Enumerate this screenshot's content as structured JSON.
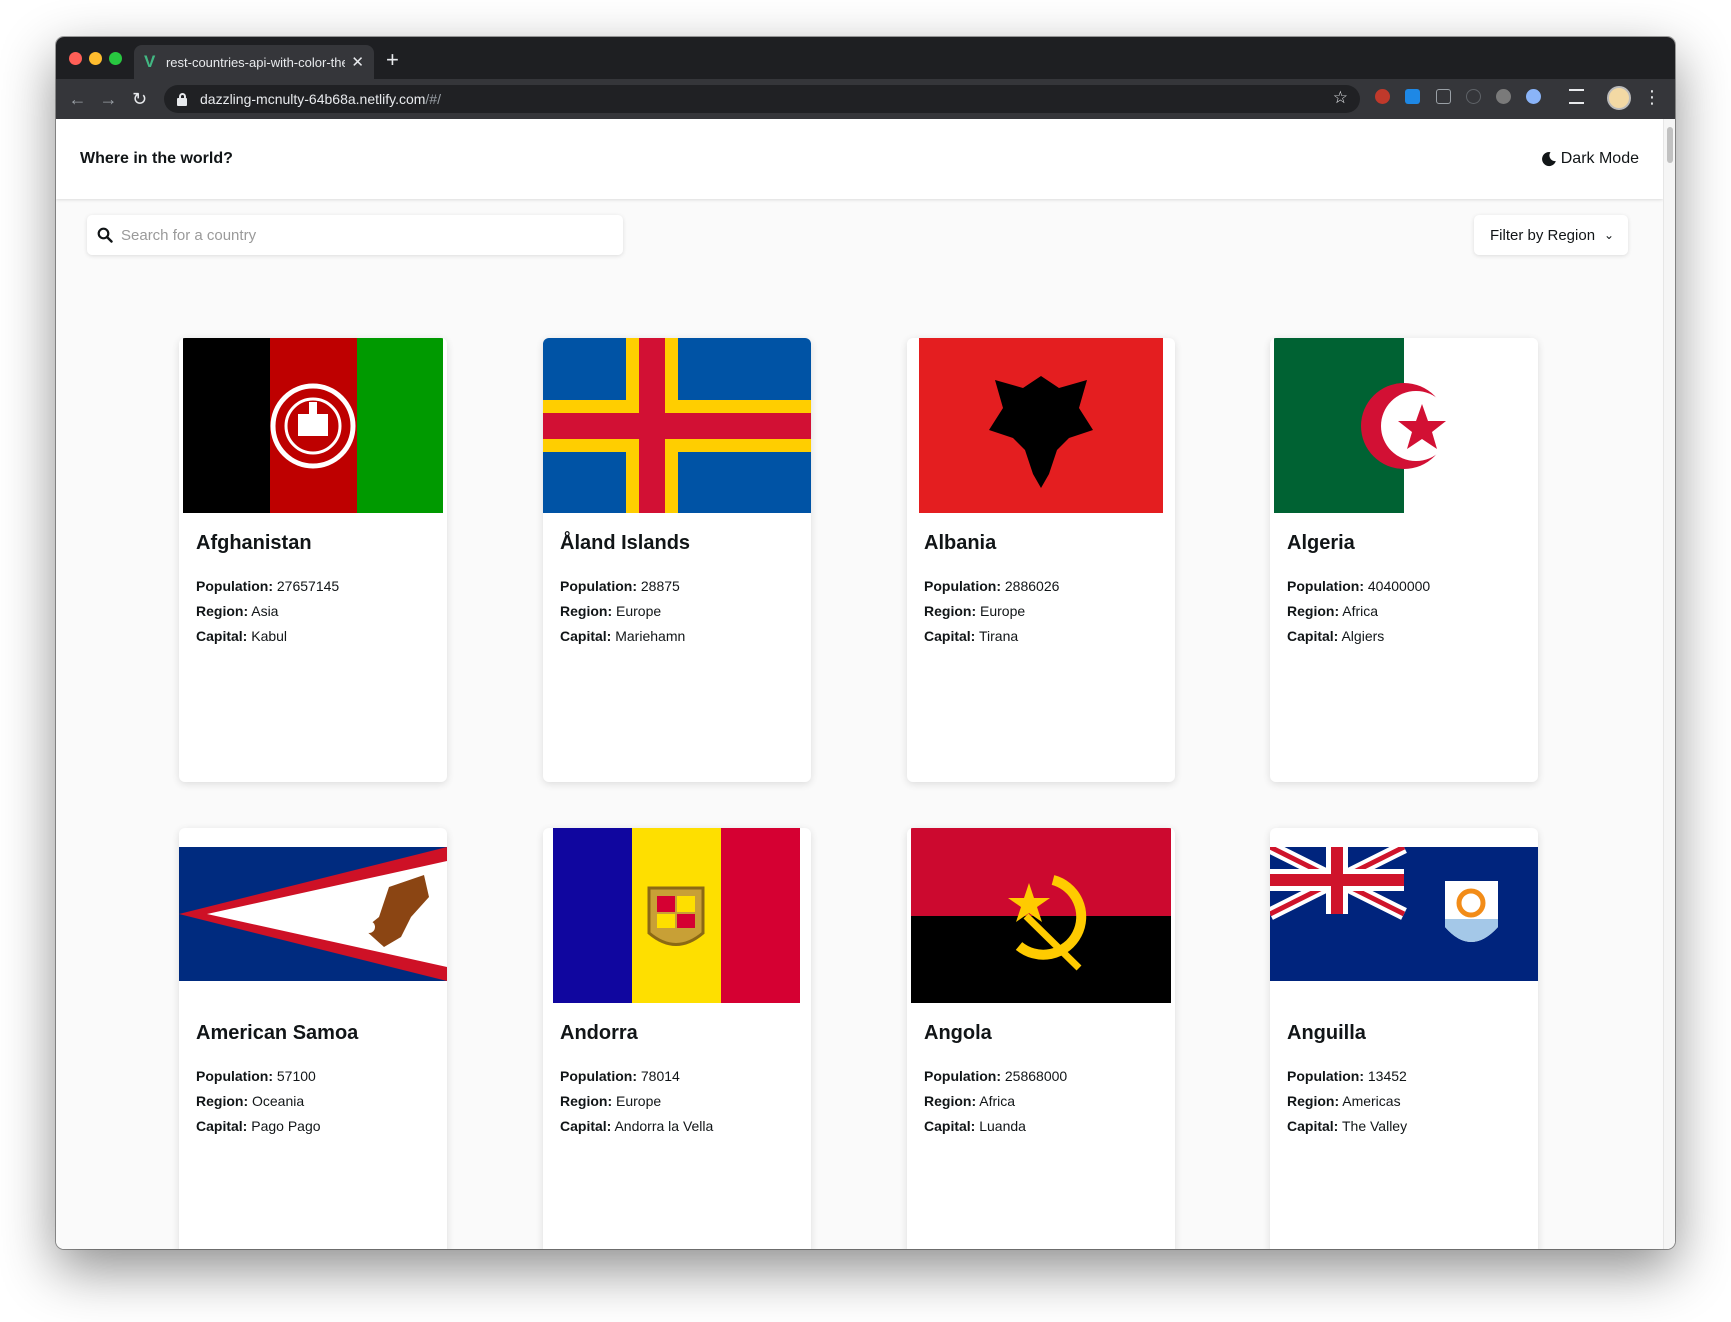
{
  "browser": {
    "tab_title": "rest-countries-api-with-color-theme",
    "tab_favicon": "V",
    "url_host": "dazzling-mcnulty-64b68a.netlify.com",
    "url_path": "/#/"
  },
  "header": {
    "title": "Where in the world?",
    "dark_mode_label": "Dark Mode"
  },
  "search": {
    "placeholder": "Search for a country"
  },
  "filter": {
    "label": "Filter by Region"
  },
  "labels": {
    "population": "Population:",
    "region": "Region:",
    "capital": "Capital:"
  },
  "countries": [
    {
      "name": "Afghanistan",
      "population": "27657145",
      "region": "Asia",
      "capital": "Kabul",
      "flag": "afghanistan-flag"
    },
    {
      "name": "Åland Islands",
      "population": "28875",
      "region": "Europe",
      "capital": "Mariehamn",
      "flag": "aland-flag"
    },
    {
      "name": "Albania",
      "population": "2886026",
      "region": "Europe",
      "capital": "Tirana",
      "flag": "albania-flag"
    },
    {
      "name": "Algeria",
      "population": "40400000",
      "region": "Africa",
      "capital": "Algiers",
      "flag": "algeria-flag"
    },
    {
      "name": "American Samoa",
      "population": "57100",
      "region": "Oceania",
      "capital": "Pago Pago",
      "flag": "american-samoa-flag"
    },
    {
      "name": "Andorra",
      "population": "78014",
      "region": "Europe",
      "capital": "Andorra la Vella",
      "flag": "andorra-flag"
    },
    {
      "name": "Angola",
      "population": "25868000",
      "region": "Africa",
      "capital": "Luanda",
      "flag": "angola-flag"
    },
    {
      "name": "Anguilla",
      "population": "13452",
      "region": "Americas",
      "capital": "The Valley",
      "flag": "anguilla-flag"
    }
  ]
}
